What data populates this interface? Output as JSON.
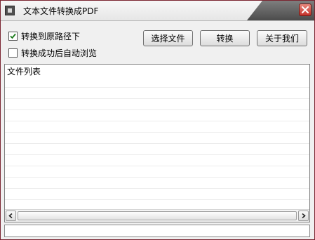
{
  "window": {
    "title": "文本文件转换成PDF",
    "close_icon": "close-icon",
    "app_icon": "app-icon"
  },
  "options": {
    "convert_to_original_path": {
      "label": "转换到原路径下",
      "checked": true
    },
    "auto_browse_after_success": {
      "label": "转换成功后自动浏览",
      "checked": false
    }
  },
  "toolbar": {
    "choose_file_label": "选择文件",
    "convert_label": "转换",
    "about_label": "关于我们"
  },
  "file_list": {
    "header": "文件列表",
    "items": []
  },
  "scrollbar": {
    "left_icon": "chevron-left-icon",
    "right_icon": "chevron-right-icon"
  },
  "status": {
    "text": ""
  },
  "colors": {
    "window_border": "#7a2430",
    "close_button": "#c3322b",
    "check_mark": "#1a7a1a"
  }
}
